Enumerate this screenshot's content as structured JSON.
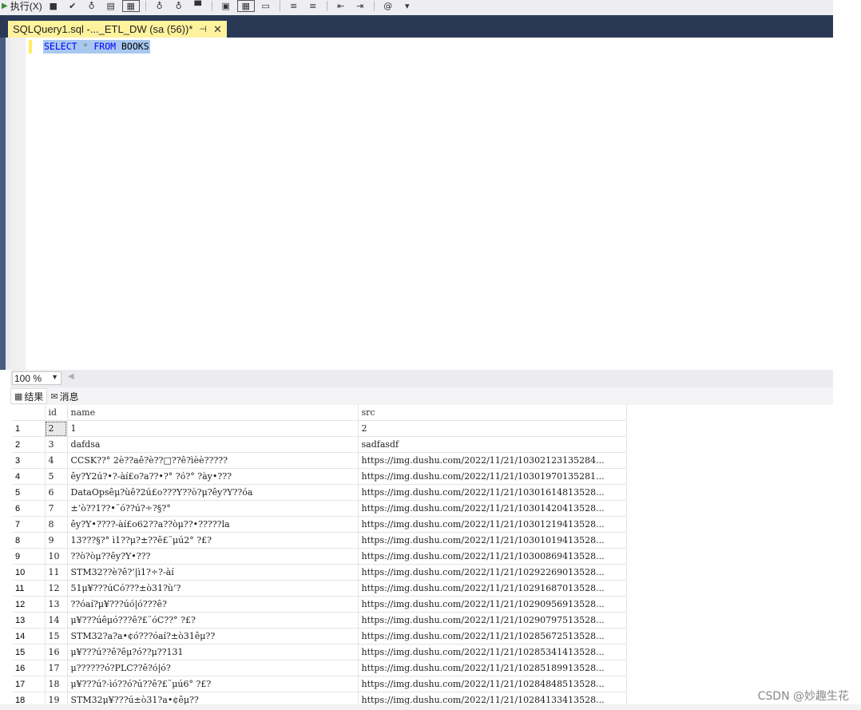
{
  "toolbar": {
    "execute_label": "执行(X)",
    "icons": [
      "stop-icon",
      "check-icon",
      "parse-icon",
      "results-to-text-icon",
      "results-to-grid-icon",
      "query-options-icon",
      "include-plan-icon",
      "estimated-plan-icon",
      "show-plan-icon",
      "comment-icon",
      "uncomment-icon",
      "decrease-indent-icon",
      "increase-indent-icon",
      "specify-values-icon"
    ]
  },
  "tab": {
    "title": "SQLQuery1.sql -..._ETL_DW (sa (56))*",
    "pin_glyph": "⊣",
    "close_glyph": "✕"
  },
  "editor": {
    "kw_select": "SELECT",
    "star": "*",
    "kw_from": "FROM",
    "table": "BOOKS"
  },
  "zoom": {
    "value": "100 %"
  },
  "results_tabs": {
    "results": "结果",
    "messages": "消息"
  },
  "grid": {
    "columns": [
      "",
      "id",
      "name",
      "src"
    ],
    "rows": [
      [
        "1",
        "2",
        "1",
        "2"
      ],
      [
        "2",
        "3",
        "dafdsa",
        "sadfasdf"
      ],
      [
        "3",
        "4",
        "CCSK??° 2è??aê?è??□??ê?ìèè?????",
        "https://img.dushu.com/2022/11/21/10302123135284..."
      ],
      [
        "4",
        "5",
        "êy?Y2ú?•?-àí£o?a??•?° ?ó?° ?ày•???",
        "https://img.dushu.com/2022/11/21/10301970135281..."
      ],
      [
        "5",
        "6",
        "DataOpsêμ?ùê?2ú£o???Y??ò?μ?êy?Y??óa",
        "https://img.dushu.com/2022/11/21/10301614813528..."
      ],
      [
        "6",
        "7",
        "±’ò??1??•¨ó??ú?÷?§?°",
        "https://img.dushu.com/2022/11/21/10301420413528..."
      ],
      [
        "7",
        "8",
        "êy?Y•????-àí£o62??a??òμ??•?????la",
        "https://img.dushu.com/2022/11/21/10301219413528..."
      ],
      [
        "8",
        "9",
        "13???§?° ì1??μ?±??ê£¨μú2° ?£?",
        "https://img.dushu.com/2022/11/21/10301019413528..."
      ],
      [
        "9",
        "10",
        "??ò?òμ??êy?Y•???",
        "https://img.dushu.com/2022/11/21/10300869413528..."
      ],
      [
        "10",
        "11",
        "STM32??è?ê?’|ì1?÷?-àí",
        "https://img.dushu.com/2022/11/21/10292269013528..."
      ],
      [
        "11",
        "12",
        "51μ¥???úCó???±ò31?ù’?",
        "https://img.dushu.com/2022/11/21/10291687013528..."
      ],
      [
        "12",
        "13",
        "??óaí?μ¥???úó|ó???ê?",
        "https://img.dushu.com/2022/11/21/10290956913528..."
      ],
      [
        "13",
        "14",
        "μ¥???úêμó???ê?£¨óC??° ?£?",
        "https://img.dushu.com/2022/11/21/10290797513528..."
      ],
      [
        "14",
        "15",
        "STM32?a?a•¢ó???óaí?±ò31êμ??",
        "https://img.dushu.com/2022/11/21/10285672513528..."
      ],
      [
        "15",
        "16",
        "μ¥???ú??ê?êμ?ó??μ??131",
        "https://img.dushu.com/2022/11/21/10285341413528..."
      ],
      [
        "16",
        "17",
        "μ??????ó?PLC??ê?ó|ó?",
        "https://img.dushu.com/2022/11/21/10285189913528..."
      ],
      [
        "17",
        "18",
        "μ¥???ú?-ìó??ó?ú??ê?£¨μú6° ?£?",
        "https://img.dushu.com/2022/11/21/10284848513528..."
      ],
      [
        "18",
        "19",
        "STM32μ¥???ú±ò31?a•¢êμ??",
        "https://img.dushu.com/2022/11/21/10284133413528..."
      ]
    ]
  },
  "watermark": "CSDN @妙趣生花"
}
